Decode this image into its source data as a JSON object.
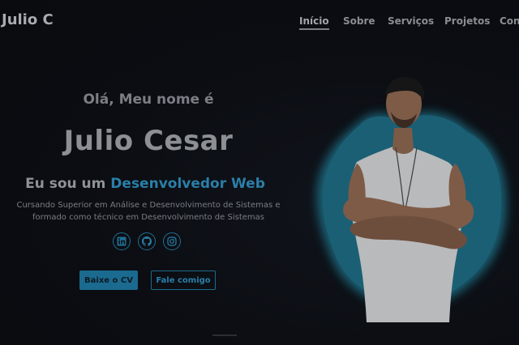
{
  "brand": {
    "logo_text": "Julio C"
  },
  "nav": {
    "items": [
      {
        "label": "Início",
        "active": true
      },
      {
        "label": "Sobre",
        "active": false
      },
      {
        "label": "Serviços",
        "active": false
      },
      {
        "label": "Projetos",
        "active": false
      },
      {
        "label": "Cont",
        "active": false
      }
    ]
  },
  "hero": {
    "greeting": "Olá, Meu nome é",
    "name": "Julio Cesar",
    "role_prefix": "Eu sou um",
    "role_highlight": "Desenvolvedor Web",
    "description_line1": "Cursando Superior em Análise e Desenvolvimento de Sistemas e",
    "description_line2": "formado como técnico em Desenvolvimento de Sistemas",
    "socials": [
      {
        "icon": "linkedin-icon"
      },
      {
        "icon": "github-icon"
      },
      {
        "icon": "instagram-icon"
      }
    ],
    "buttons": {
      "download_cv": "Baixe o CV",
      "contact": "Fale comigo"
    }
  },
  "colors": {
    "background": "#0b0d12",
    "accent": "#1b6a8f",
    "accent_text": "#2a7fa8",
    "blob_glow": "#1c6e84"
  }
}
